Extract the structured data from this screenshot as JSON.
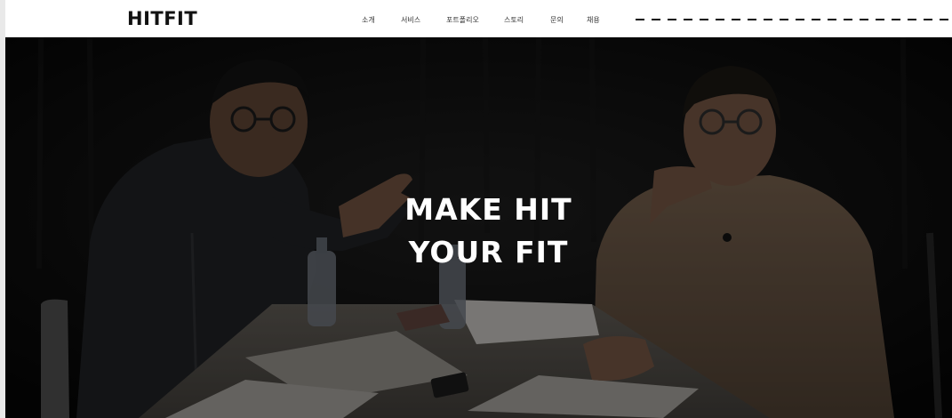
{
  "header": {
    "logo": "HITFIT",
    "nav": [
      {
        "label": "소개"
      },
      {
        "label": "서비스"
      },
      {
        "label": "포트폴리오"
      },
      {
        "label": "스토리"
      },
      {
        "label": "문의"
      },
      {
        "label": "채용"
      }
    ]
  },
  "hero": {
    "headline_line1": "MAKE HIT",
    "headline_line2": "YOUR FIT"
  },
  "colors": {
    "header_bg": "#ffffff",
    "hero_overlay": "#000000",
    "headline": "#ffffff",
    "logo": "#111111"
  }
}
